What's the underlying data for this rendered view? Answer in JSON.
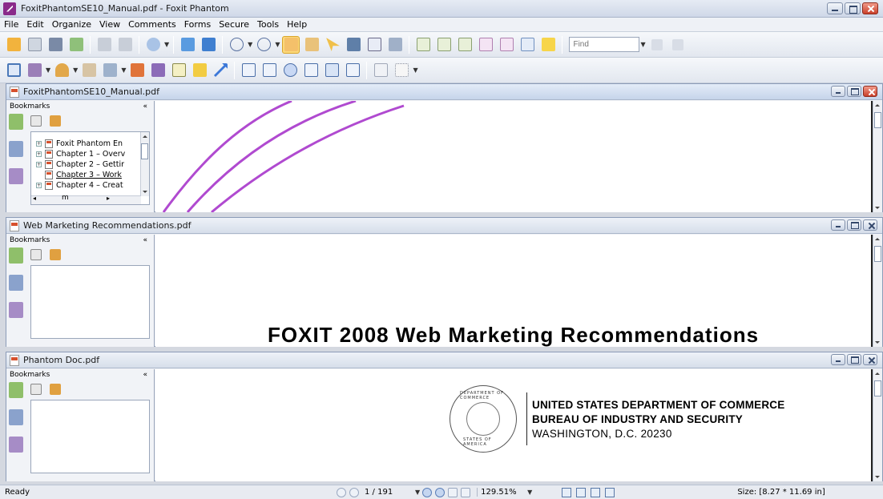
{
  "app": {
    "title": "FoxitPhantomSE10_Manual.pdf - Foxit Phantom"
  },
  "menu": [
    "File",
    "Edit",
    "Organize",
    "View",
    "Comments",
    "Forms",
    "Secure",
    "Tools",
    "Help"
  ],
  "toolbar": {
    "find_placeholder": "Find",
    "toolbar1_icons": [
      "open-icon",
      "save-icon",
      "print-icon",
      "email-icon",
      "scan-icon",
      "cart-icon",
      "zoom-in-icon",
      "fit-page-icon",
      "fit-width-icon",
      "zoom-out-icon",
      "zoom-plus-icon",
      "hand-icon",
      "text-select-icon",
      "arrow-select-icon",
      "binoculars-icon",
      "typewriter-icon",
      "snapshot-icon",
      "text-tool-a",
      "text-tool-b",
      "text-tool-c",
      "text-tool-d",
      "text-tool-e",
      "text-tool-f",
      "note-icon"
    ],
    "toolbar2_icons": [
      "rectangle-form-icon",
      "edit-doc-icon",
      "user-icon",
      "stamp-icon",
      "lock-icon",
      "pencil-icon",
      "sign-icon",
      "text-box-icon",
      "callout-icon",
      "arrow-tool-icon",
      "text-field-icon",
      "checkbox-icon",
      "radio-icon",
      "list-box-icon",
      "combo-box-icon",
      "text-area-icon",
      "image-field-icon",
      "pattern-icon"
    ]
  },
  "windows": [
    {
      "name": "FoxitPhantomSE10_Manual.pdf",
      "panel_title": "Bookmarks",
      "bookmarks": [
        {
          "label": "Foxit Phantom En",
          "expander": "+"
        },
        {
          "label": "Chapter 1 – Overv",
          "expander": "+"
        },
        {
          "label": "Chapter 2 – Gettir",
          "expander": "+"
        },
        {
          "label": "Chapter 3 – Work",
          "expander": ""
        },
        {
          "label": "Chapter 4 – Creat",
          "expander": "+"
        }
      ],
      "scroll_glyph": "m"
    },
    {
      "name": "Web Marketing Recommendations.pdf",
      "panel_title": "Bookmarks",
      "heading_partial": "FOXIT 2008 Web Marketing Recommendations"
    },
    {
      "name": "Phantom Doc.pdf",
      "panel_title": "Bookmarks",
      "letterhead": {
        "line1": "UNITED STATES DEPARTMENT OF COMMERCE",
        "line2": "BUREAU OF INDUSTRY AND SECURITY",
        "line3": "WASHINGTON, D.C. 20230",
        "seal_top": "DEPARTMENT OF COMMERCE",
        "seal_bottom": "STATES OF AMERICA"
      }
    }
  ],
  "status": {
    "ready": "Ready",
    "page": "1 / 191",
    "zoom": "129.51%",
    "size": "Size: [8.27 * 11.69 in]"
  },
  "colors": {
    "curve": "#b04ad0",
    "accent": "#c5d6f0"
  }
}
